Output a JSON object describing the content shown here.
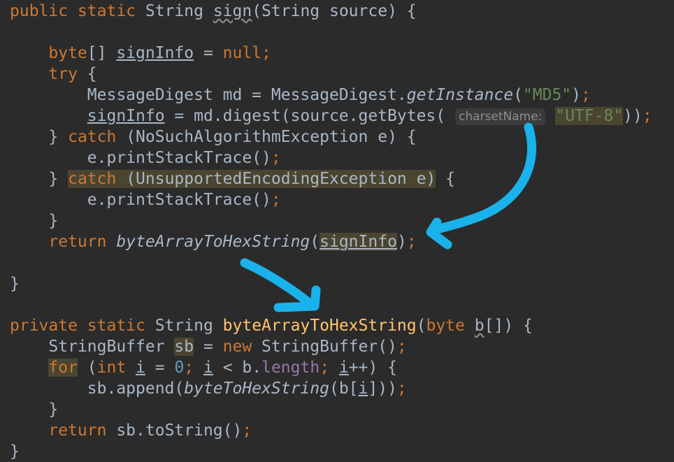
{
  "code": {
    "lines": [
      [
        {
          "t": "public static ",
          "c": "kw"
        },
        {
          "t": "String "
        },
        {
          "t": "sign",
          "c": "wavy"
        },
        {
          "t": "(String source) {"
        }
      ],
      [],
      [
        {
          "t": "    "
        },
        {
          "t": "byte",
          "c": "kw"
        },
        {
          "t": "[] "
        },
        {
          "t": "signInfo",
          "c": "ul"
        },
        {
          "t": " = "
        },
        {
          "t": "null",
          "c": "kw"
        },
        {
          "t": ";",
          "c": "kw"
        }
      ],
      [
        {
          "t": "    "
        },
        {
          "t": "try",
          "c": "kw"
        },
        {
          "t": " {"
        }
      ],
      [
        {
          "t": "        MessageDigest md = MessageDigest."
        },
        {
          "t": "getInstance",
          "c": "it"
        },
        {
          "t": "("
        },
        {
          "t": "\"MD5\"",
          "c": "str"
        },
        {
          "t": ")"
        },
        {
          "t": ";",
          "c": "kw"
        }
      ],
      [
        {
          "t": "        "
        },
        {
          "t": "signInfo",
          "c": "ul"
        },
        {
          "t": " = md.digest(source.getBytes( "
        },
        {
          "t": "charsetName:",
          "c": "hint"
        },
        {
          "t": " "
        },
        {
          "t": "\"UTF-8\"",
          "c": "str hl"
        },
        {
          "t": "))"
        },
        {
          "t": ";",
          "c": "kw"
        }
      ],
      [
        {
          "t": "    } "
        },
        {
          "t": "catch",
          "c": "kw"
        },
        {
          "t": " (NoSuchAlgorithmException e) {"
        }
      ],
      [
        {
          "t": "        e.printStackTrace()"
        },
        {
          "t": ";",
          "c": "kw"
        }
      ],
      [
        {
          "t": "    } "
        },
        {
          "t": "catch",
          "c": "kw hl"
        },
        {
          "t": " (UnsupportedEncodingException e)",
          "c": "hl"
        },
        {
          "t": " {"
        }
      ],
      [
        {
          "t": "        e.printStackTrace()"
        },
        {
          "t": ";",
          "c": "kw"
        }
      ],
      [
        {
          "t": "    }"
        }
      ],
      [
        {
          "t": "    "
        },
        {
          "t": "return ",
          "c": "kw"
        },
        {
          "t": "byteArrayToHexString",
          "c": "it"
        },
        {
          "t": "("
        },
        {
          "t": "signInfo",
          "c": "ul hl"
        },
        {
          "t": ")"
        },
        {
          "t": ";",
          "c": "kw"
        }
      ],
      [],
      [
        {
          "t": "}"
        }
      ],
      [],
      [
        {
          "t": "private static ",
          "c": "kw"
        },
        {
          "t": "String "
        },
        {
          "t": "byteArrayToHexString",
          "c": "fn"
        },
        {
          "t": "("
        },
        {
          "t": "byte ",
          "c": "kw"
        },
        {
          "t": "b",
          "c": "wavy"
        },
        {
          "t": "[]) {"
        }
      ],
      [
        {
          "t": "    StringBuffer "
        },
        {
          "t": "sb",
          "c": "hl"
        },
        {
          "t": " = "
        },
        {
          "t": "new ",
          "c": "kw"
        },
        {
          "t": "StringBuffer()"
        },
        {
          "t": ";",
          "c": "kw"
        }
      ],
      [
        {
          "t": "    "
        },
        {
          "t": "for",
          "c": "kw hl"
        },
        {
          "t": " ("
        },
        {
          "t": "int ",
          "c": "kw"
        },
        {
          "t": "i",
          "c": "ul"
        },
        {
          "t": " = "
        },
        {
          "t": "0",
          "c": "num"
        },
        {
          "t": "; ",
          "c": "kw"
        },
        {
          "t": "i",
          "c": "ul"
        },
        {
          "t": " < b."
        },
        {
          "t": "length",
          "c": "fld"
        },
        {
          "t": "; ",
          "c": "kw"
        },
        {
          "t": "i",
          "c": "ul"
        },
        {
          "t": "++) {"
        }
      ],
      [
        {
          "t": "        sb.append("
        },
        {
          "t": "byteToHexString",
          "c": "it"
        },
        {
          "t": "(b["
        },
        {
          "t": "i",
          "c": "ul"
        },
        {
          "t": "]))"
        },
        {
          "t": ";",
          "c": "kw"
        }
      ],
      [
        {
          "t": "    }"
        }
      ],
      [
        {
          "t": "    "
        },
        {
          "t": "return ",
          "c": "kw"
        },
        {
          "t": "sb.toString()"
        },
        {
          "t": ";",
          "c": "kw"
        }
      ],
      [
        {
          "t": "}"
        }
      ]
    ]
  },
  "annotations": {
    "arrow_color": "#1ab2ea",
    "arrows": [
      "hand-drawn-curved-arrow",
      "hand-drawn-straight-arrow"
    ]
  }
}
